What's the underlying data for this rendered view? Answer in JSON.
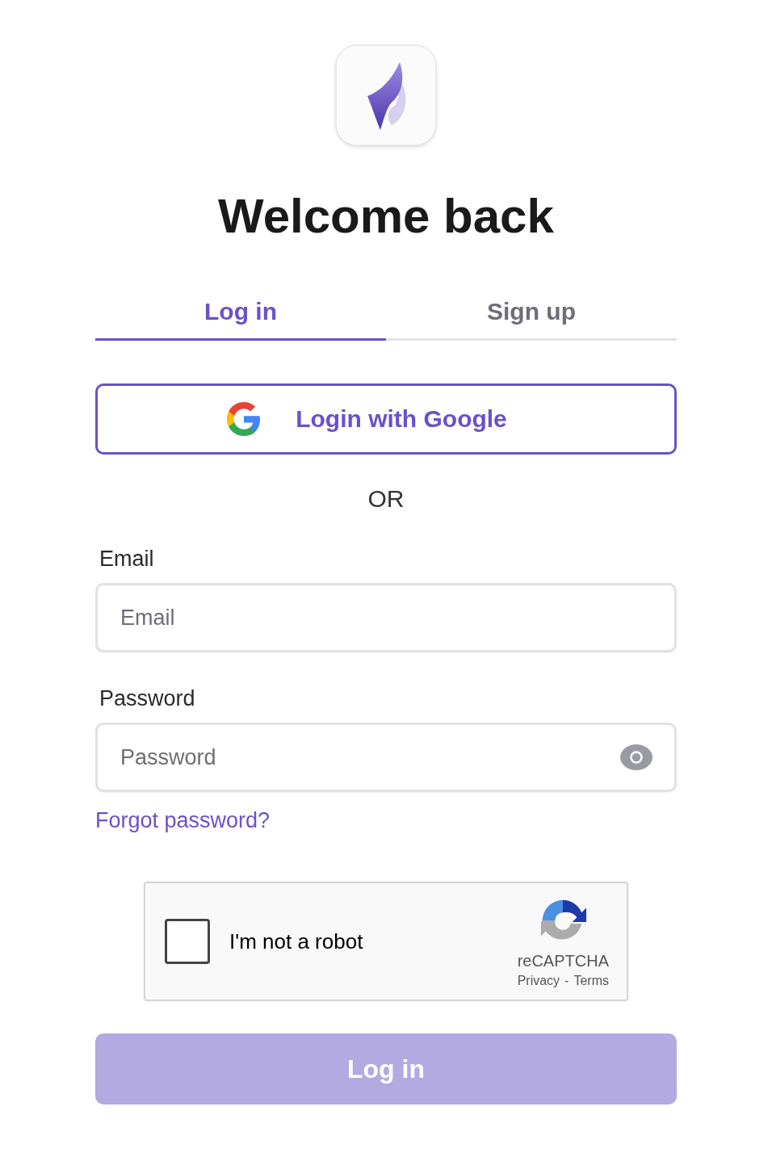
{
  "title": "Welcome back",
  "tabs": [
    {
      "label": "Log in",
      "selected": true
    },
    {
      "label": "Sign up",
      "selected": false
    }
  ],
  "google_button": {
    "label": "Login with Google"
  },
  "separator": "OR",
  "fields": [
    {
      "kind": "email",
      "label": "Email",
      "placeholder": "Email"
    },
    {
      "kind": "password",
      "label": "Password",
      "placeholder": "Password"
    }
  ],
  "forgot_link": "Forgot password?",
  "captcha": {
    "label": "I'm not a robot",
    "checked": false,
    "brand": "reCAPTCHA",
    "privacy": "Privacy",
    "dash": "-",
    "terms": "Terms"
  },
  "submit": {
    "label": "Log in",
    "disabled": true
  }
}
